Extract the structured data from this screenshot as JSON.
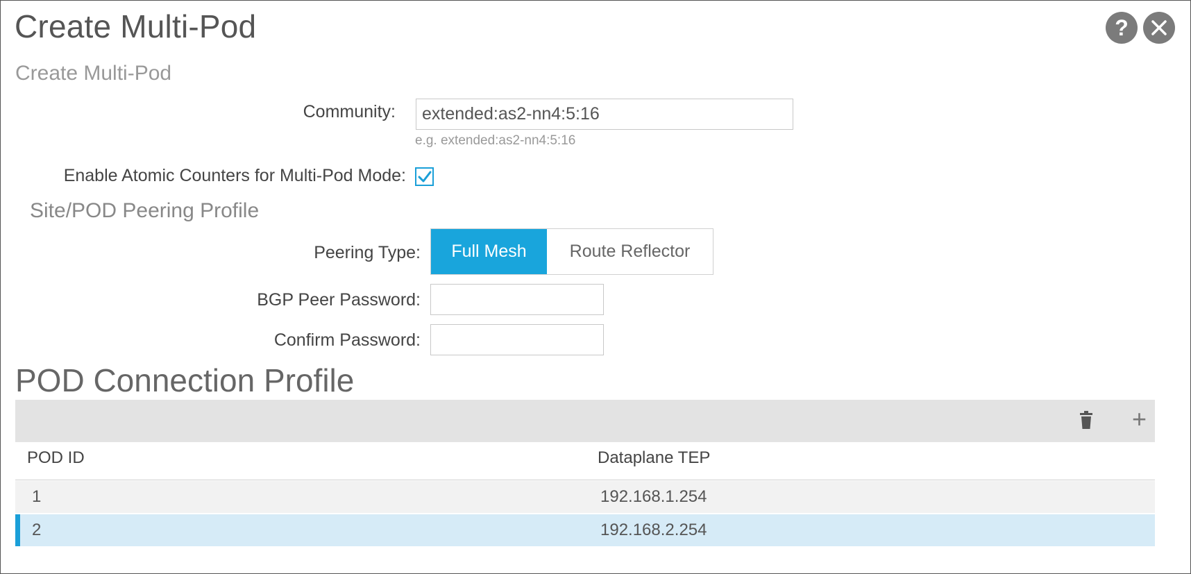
{
  "dialog": {
    "title": "Create Multi-Pod",
    "help_icon": "help-icon",
    "close_icon": "close-icon"
  },
  "form": {
    "subtitle": "Create Multi-Pod",
    "community_label": "Community:",
    "community_value": "extended:as2-nn4:5:16",
    "community_hint": "e.g. extended:as2-nn4:5:16",
    "atomic_label": "Enable Atomic Counters for Multi-Pod Mode:",
    "atomic_checked": true,
    "peering_section": "Site/POD Peering Profile",
    "peering_type_label": "Peering Type:",
    "peering_options": [
      "Full Mesh",
      "Route Reflector"
    ],
    "peering_selected": "Full Mesh",
    "bgp_password_label": "BGP Peer Password:",
    "confirm_password_label": "Confirm Password:"
  },
  "pod_profile": {
    "heading": "POD Connection Profile",
    "columns": [
      "POD ID",
      "Dataplane TEP"
    ],
    "rows": [
      {
        "pod_id": "1",
        "tep": "192.168.1.254"
      },
      {
        "pod_id": "2",
        "tep": "192.168.2.254"
      }
    ],
    "selected_row": "2"
  },
  "colors": {
    "accent": "#19a5dc",
    "selected_row_bg": "#d6ebf7",
    "toolbar_bg": "#e3e3e3"
  }
}
